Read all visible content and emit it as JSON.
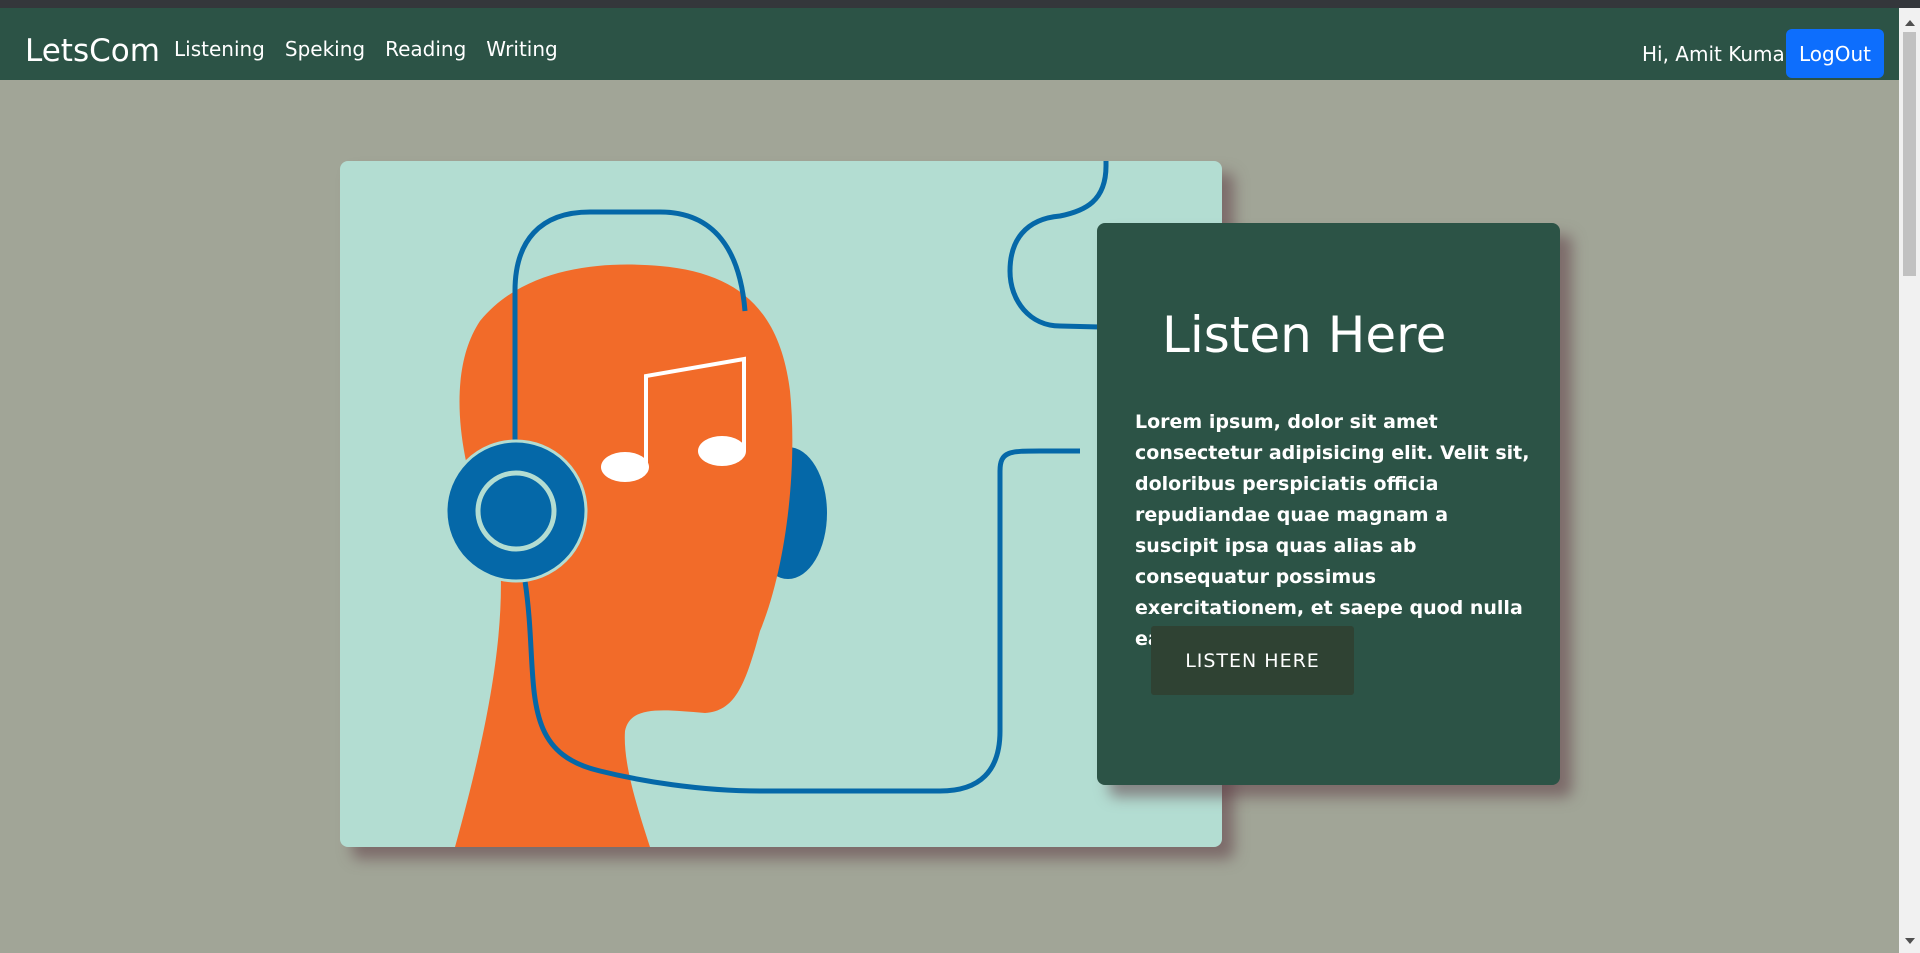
{
  "navbar": {
    "brand": "LetsCom",
    "links": [
      "Listening",
      "Speking",
      "Reading",
      "Writing"
    ],
    "greeting": "Hi, Amit Kumar",
    "logout_label": "LogOut"
  },
  "hero": {
    "illustration": "person-with-headphones-music-note",
    "title": "Listen Here",
    "description": "Lorem ipsum, dolor sit amet consectetur adipisicing elit. Velit sit, doloribus perspiciatis officia repudiandae quae magnam a suscipit ipsa quas alias ab consequatur possimus exercitationem, et saepe quod nulla earum?",
    "button_label": "LISTEN HERE"
  },
  "colors": {
    "navbar_bg": "#2c5346",
    "page_bg": "#a1a597",
    "logout_bg": "#0d6efd",
    "illustration_bg": "#b3ddd2",
    "head_orange": "#f26b29",
    "headphone_blue": "#0568a8",
    "card_button_bg": "#2f4233"
  }
}
